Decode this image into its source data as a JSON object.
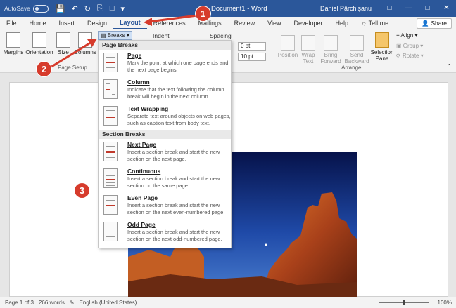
{
  "titlebar": {
    "autosave": "AutoSave",
    "toggle": "Off",
    "title": "Document1 - Word",
    "user": "Daniel Pârchișanu"
  },
  "tabs": [
    "File",
    "Home",
    "Insert",
    "Design",
    "Layout",
    "References",
    "Mailings",
    "Review",
    "View",
    "Developer",
    "Help"
  ],
  "tell_me": "Tell me",
  "share": "Share",
  "ribbon": {
    "margins": "Margins",
    "orientation": "Orientation",
    "size": "Size",
    "columns": "Columns",
    "page_setup": "Page Setup",
    "breaks": "Breaks",
    "indent": "Indent",
    "spacing": "Spacing",
    "spacing_before": "0 pt",
    "spacing_after": "10 pt",
    "position": "Position",
    "wrap_text": "Wrap Text",
    "bring_forward": "Bring Forward",
    "send_backward": "Send Backward",
    "selection_pane": "Selection Pane",
    "align": "Align",
    "group": "Group",
    "rotate": "Rotate",
    "arrange": "Arrange"
  },
  "menu": {
    "page_breaks_header": "Page Breaks",
    "section_breaks_header": "Section Breaks",
    "items": [
      {
        "title": "Page",
        "desc": "Mark the point at which one page ends and the next page begins."
      },
      {
        "title": "Column",
        "desc": "Indicate that the text following the column break will begin in the next column."
      },
      {
        "title": "Text Wrapping",
        "desc": "Separate text around objects on web pages, such as caption text from body text."
      },
      {
        "title": "Next Page",
        "desc": "Insert a section break and start the new section on the next page."
      },
      {
        "title": "Continuous",
        "desc": "Insert a section break and start the new section on the same page."
      },
      {
        "title": "Even Page",
        "desc": "Insert a section break and start the new section on the next even-numbered page."
      },
      {
        "title": "Odd Page",
        "desc": "Insert a section break and start the new section on the next odd-numbered page."
      }
    ]
  },
  "status": {
    "page": "Page 1 of 3",
    "words": "266 words",
    "language": "English (United States)",
    "zoom": "100%"
  },
  "badges": [
    "1",
    "2",
    "3"
  ],
  "colors": {
    "title_bar": "#2b579a",
    "annotation": "#d63b2c"
  }
}
